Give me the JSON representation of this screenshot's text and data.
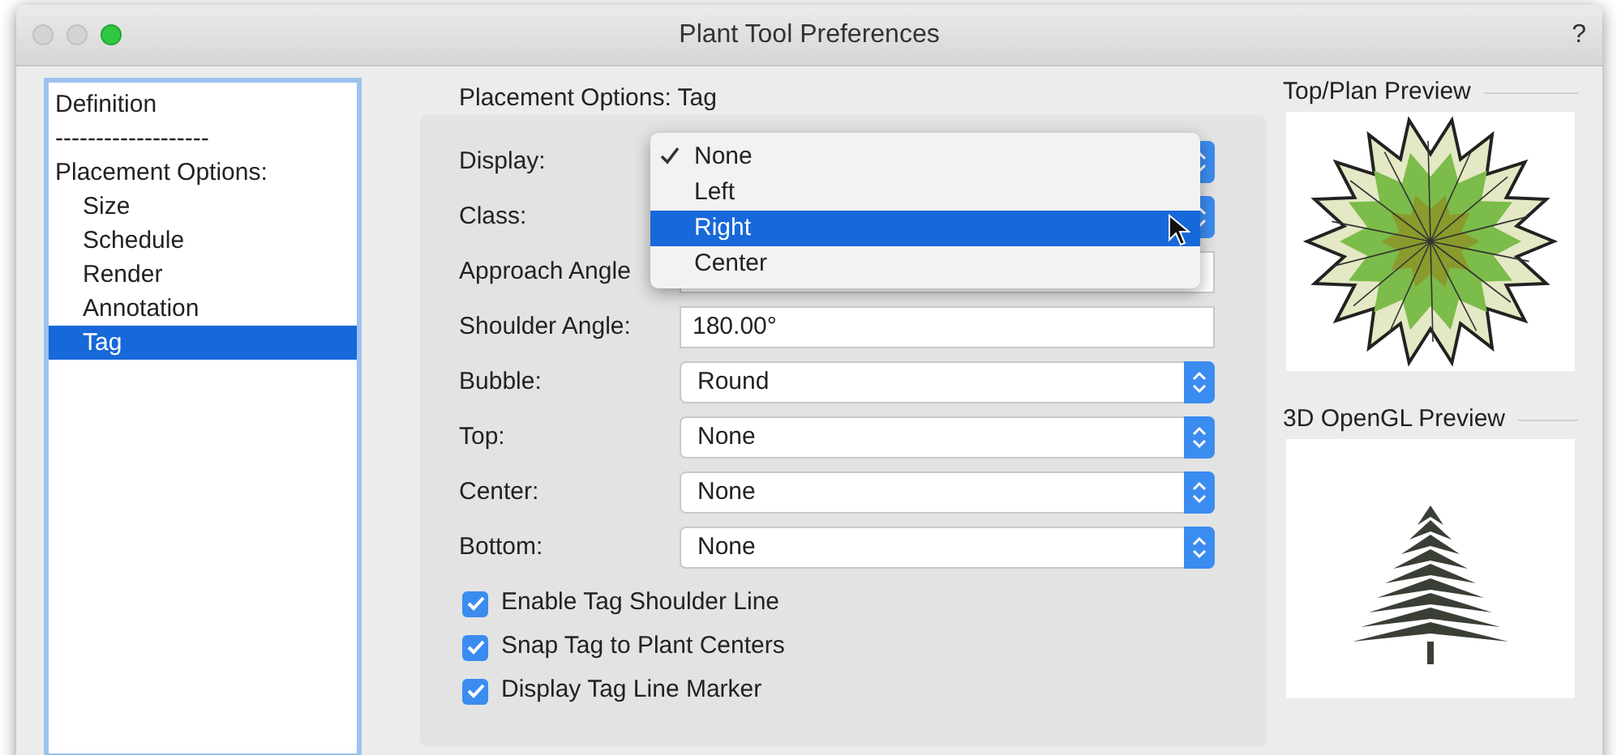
{
  "window": {
    "title": "Plant Tool Preferences",
    "help": "?"
  },
  "sidebar": {
    "items": [
      {
        "label": "Definition",
        "selected": false
      },
      {
        "label": "-------------------",
        "selected": false
      },
      {
        "label": "Placement Options:",
        "selected": false,
        "children": [
          {
            "label": "Size",
            "selected": false
          },
          {
            "label": "Schedule",
            "selected": false
          },
          {
            "label": "Render",
            "selected": false
          },
          {
            "label": "Annotation",
            "selected": false
          },
          {
            "label": "Tag",
            "selected": true
          }
        ]
      }
    ]
  },
  "panel": {
    "title": "Placement Options: Tag",
    "fields": [
      {
        "label": "Display:",
        "kind": "popup"
      },
      {
        "label": "Class:",
        "kind": "popup"
      },
      {
        "label": "Approach Angle",
        "kind": "text"
      },
      {
        "label": "Shoulder Angle:",
        "kind": "text",
        "value": "180.00°"
      },
      {
        "label": "Bubble:",
        "kind": "popup",
        "value": "Round"
      },
      {
        "label": "Top:",
        "kind": "popup",
        "value": "None"
      },
      {
        "label": "Center:",
        "kind": "popup",
        "value": "None"
      },
      {
        "label": "Bottom:",
        "kind": "popup",
        "value": "None"
      }
    ],
    "checkboxes": [
      {
        "label": "Enable Tag Shoulder Line",
        "checked": true
      },
      {
        "label": "Snap Tag to Plant Centers",
        "checked": true
      },
      {
        "label": "Display Tag Line Marker",
        "checked": true
      }
    ]
  },
  "menu": {
    "items": [
      {
        "label": "None",
        "checked": true,
        "selected": false
      },
      {
        "label": "Left",
        "checked": false,
        "selected": false
      },
      {
        "label": "Right",
        "checked": false,
        "selected": true
      },
      {
        "label": "Center",
        "checked": false,
        "selected": false
      }
    ]
  },
  "previews": [
    {
      "title": "Top/Plan Preview",
      "kind": "plan"
    },
    {
      "title": "3D OpenGL Preview",
      "kind": "model"
    }
  ]
}
